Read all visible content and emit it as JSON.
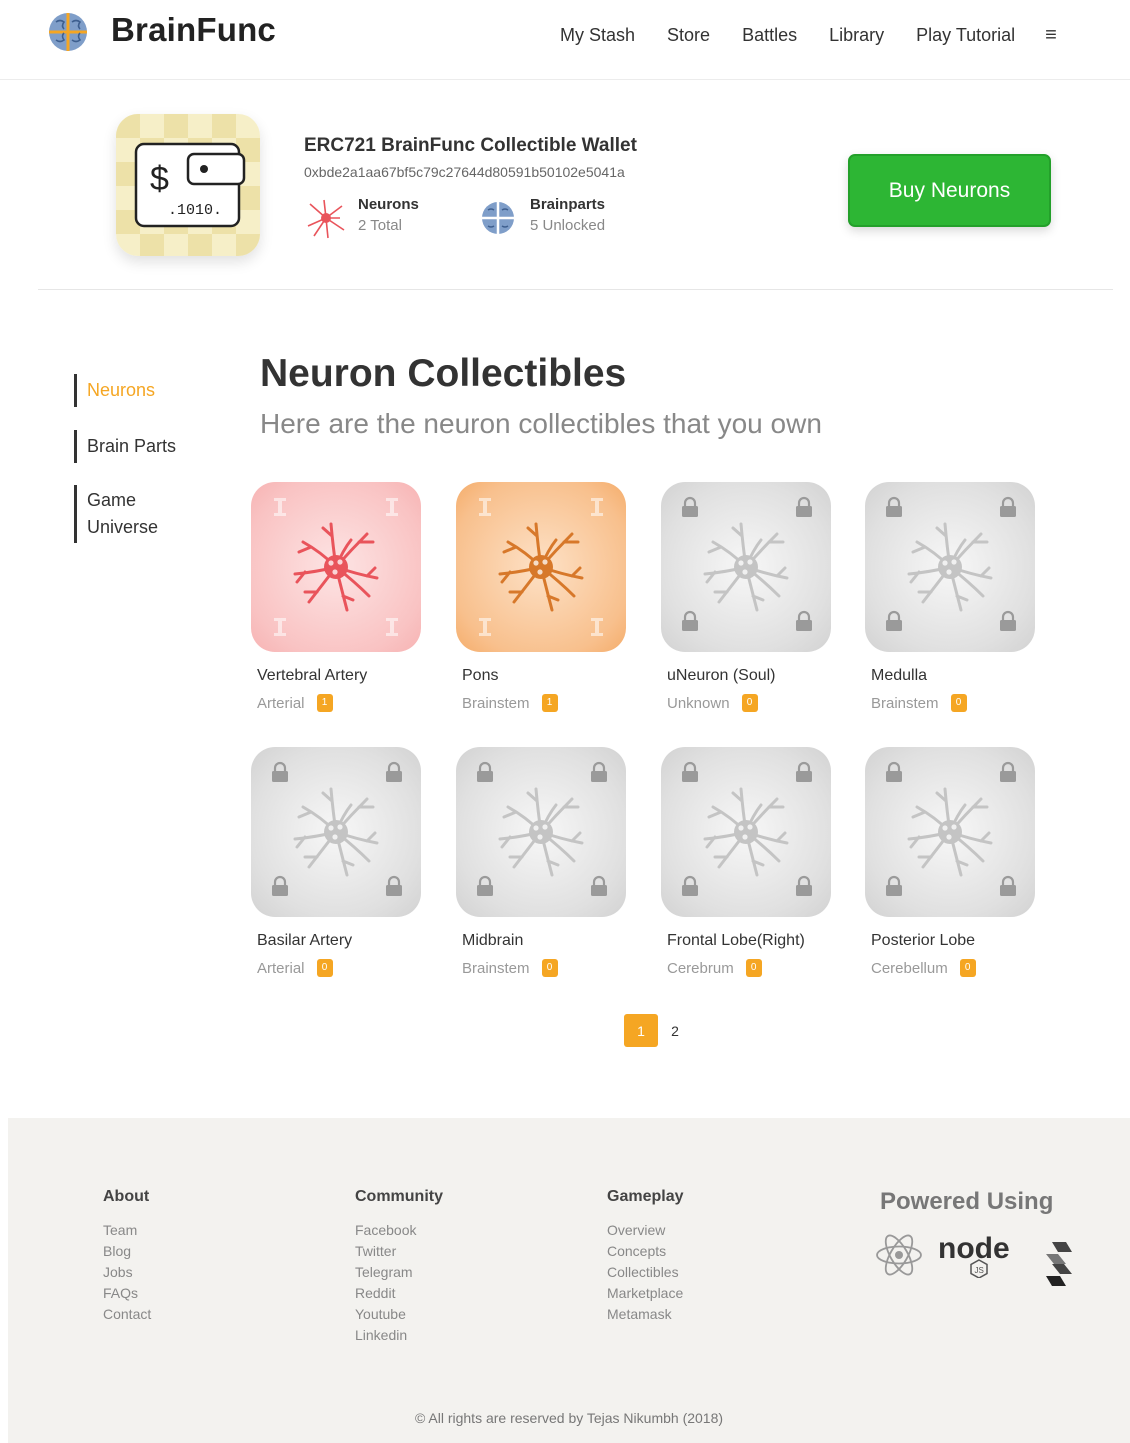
{
  "header": {
    "brand": "BrainFunc",
    "nav": [
      "My Stash",
      "Store",
      "Battles",
      "Library",
      "Play Tutorial"
    ],
    "menu_icon": "hamburger-icon",
    "menu_glyph": "≡"
  },
  "wallet": {
    "title": "ERC721 BrainFunc Collectible Wallet",
    "address": "0xbde2a1aa67bf5c79c27644d80591b50102e5041a",
    "tile_text_dollar": "$",
    "tile_text_code": ".1010.",
    "stats": [
      {
        "label": "Neurons",
        "value": "2 Total",
        "icon": "neuron-icon"
      },
      {
        "label": "Brainparts",
        "value": "5 Unlocked",
        "icon": "brain-icon"
      }
    ],
    "buy_button": "Buy Neurons"
  },
  "sidenav": {
    "items": [
      "Neurons",
      "Brain Parts",
      "Game Universe"
    ],
    "active": "Neurons"
  },
  "main": {
    "title": "Neuron Collectibles",
    "subtitle": "Here are the neuron collectibles that you own",
    "cards": [
      {
        "name": "Vertebral Artery",
        "category": "Arterial",
        "count": "1",
        "style": "pink",
        "locked": false
      },
      {
        "name": "Pons",
        "category": "Brainstem",
        "count": "1",
        "style": "orange",
        "locked": false
      },
      {
        "name": "uNeuron (Soul)",
        "category": "Unknown",
        "count": "0",
        "style": "gray",
        "locked": true
      },
      {
        "name": "Medulla",
        "category": "Brainstem",
        "count": "0",
        "style": "gray",
        "locked": true
      },
      {
        "name": "Basilar Artery",
        "category": "Arterial",
        "count": "0",
        "style": "gray",
        "locked": true
      },
      {
        "name": "Midbrain",
        "category": "Brainstem",
        "count": "0",
        "style": "gray",
        "locked": true
      },
      {
        "name": "Frontal Lobe(Right)",
        "category": "Cerebrum",
        "count": "0",
        "style": "gray",
        "locked": true
      },
      {
        "name": "Posterior Lobe",
        "category": "Cerebellum",
        "count": "0",
        "style": "gray",
        "locked": true
      }
    ],
    "pages": [
      "1",
      "2"
    ],
    "current_page": "1"
  },
  "footer": {
    "columns": [
      {
        "heading": "About",
        "links": [
          "Team",
          "Blog",
          "Jobs",
          "FAQs",
          "Contact"
        ]
      },
      {
        "heading": "Community",
        "links": [
          "Facebook",
          "Twitter",
          "Telegram",
          "Reddit",
          "Youtube",
          "Linkedin"
        ]
      },
      {
        "heading": "Gameplay",
        "links": [
          "Overview",
          "Concepts",
          "Collectibles",
          "Marketplace",
          "Metamask"
        ]
      }
    ],
    "powered_heading": "Powered Using",
    "tech_icons": [
      "react-icon",
      "nodejs-icon",
      "solidity-icon"
    ],
    "node_logo_text": "node",
    "node_logo_sub": "JS",
    "copyright": "© All rights are reserved by Tejas Nikumbh (2018)"
  },
  "colors": {
    "accent": "#f5a623",
    "buy_green": "#2db634",
    "footer_bg": "#f3f2ef",
    "neuron_pink": "#e9545b",
    "neuron_orange": "#d7782a",
    "neuron_gray": "#c4c4c4"
  }
}
